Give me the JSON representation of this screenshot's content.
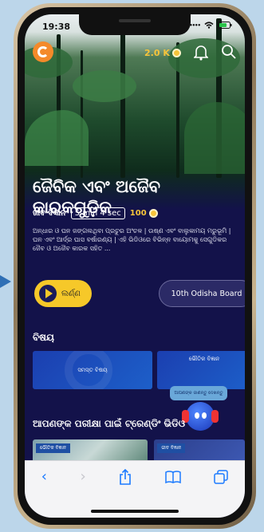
{
  "status": {
    "time": "19:38"
  },
  "header": {
    "coins": "2.0 K"
  },
  "content": {
    "title": "ଜୈବିକ ଏବଂ ଅଜୈବ କାରକଗୁଡ଼ିକ",
    "subject": "ଜୀବ ବିଜ୍ଞାନ",
    "duration": "5 min 4 sec",
    "points": "100",
    "description": "ଅନ୍ଧାର ଓ ଘନ ଜଙ୍ଗଲଥିବା ପ୍ରଚୁର ଅଂଚଳ | ଉଷ୍ଣ ଏବଂ ବାଲୁକାମୟ ମରୁଭୂମି | ଘନ ଏବଂ ଆର୍ଦ୍ର ଘାସ ବର୍ଷାରଣ୍ୟ | ଏହି ଭିଡିଓରେ ବିଭିନ୍ନ ବାୟୋମକୁ ସେଗୁଡିକର ଜୈବ ଓ ଅଜୈବ କାରକ ସହିତ ...",
    "learn_label": "ଲର୍ଣ୍ଣ",
    "board_label": "10th Odisha Board"
  },
  "topics": {
    "heading": "ବିଷୟ",
    "cards": [
      {
        "label": "ସମସ୍ତ ବିଷୟ"
      },
      {
        "label": "ଭୌତିକ ବିଜ୍ଞାନ"
      }
    ]
  },
  "trending": {
    "heading": "ଆପଣଙ୍କ ପରୀକ୍ଷା ପାଇଁ ଟ୍ରେଣ୍ଡିଂ ଭିଡିଓ",
    "thumbs": [
      {
        "tag": "ଭୌତିକ ବିଜ୍ଞାନ"
      },
      {
        "tag": "ଜୀବ ବିଜ୍ଞାନ"
      }
    ]
  },
  "assistant": {
    "bubble": "ଆପଣଙ୍କ ଜାଣନ୍ତୁ ଦେଖନ୍ତୁ"
  },
  "icons": {
    "back": "chevron-left-icon",
    "forward": "chevron-right-icon",
    "share": "share-icon",
    "bookmarks": "book-icon",
    "tabs": "tabs-icon"
  },
  "colors": {
    "accent": "#f6c829",
    "background": "#13124a",
    "safari_blue": "#1b7aff"
  }
}
